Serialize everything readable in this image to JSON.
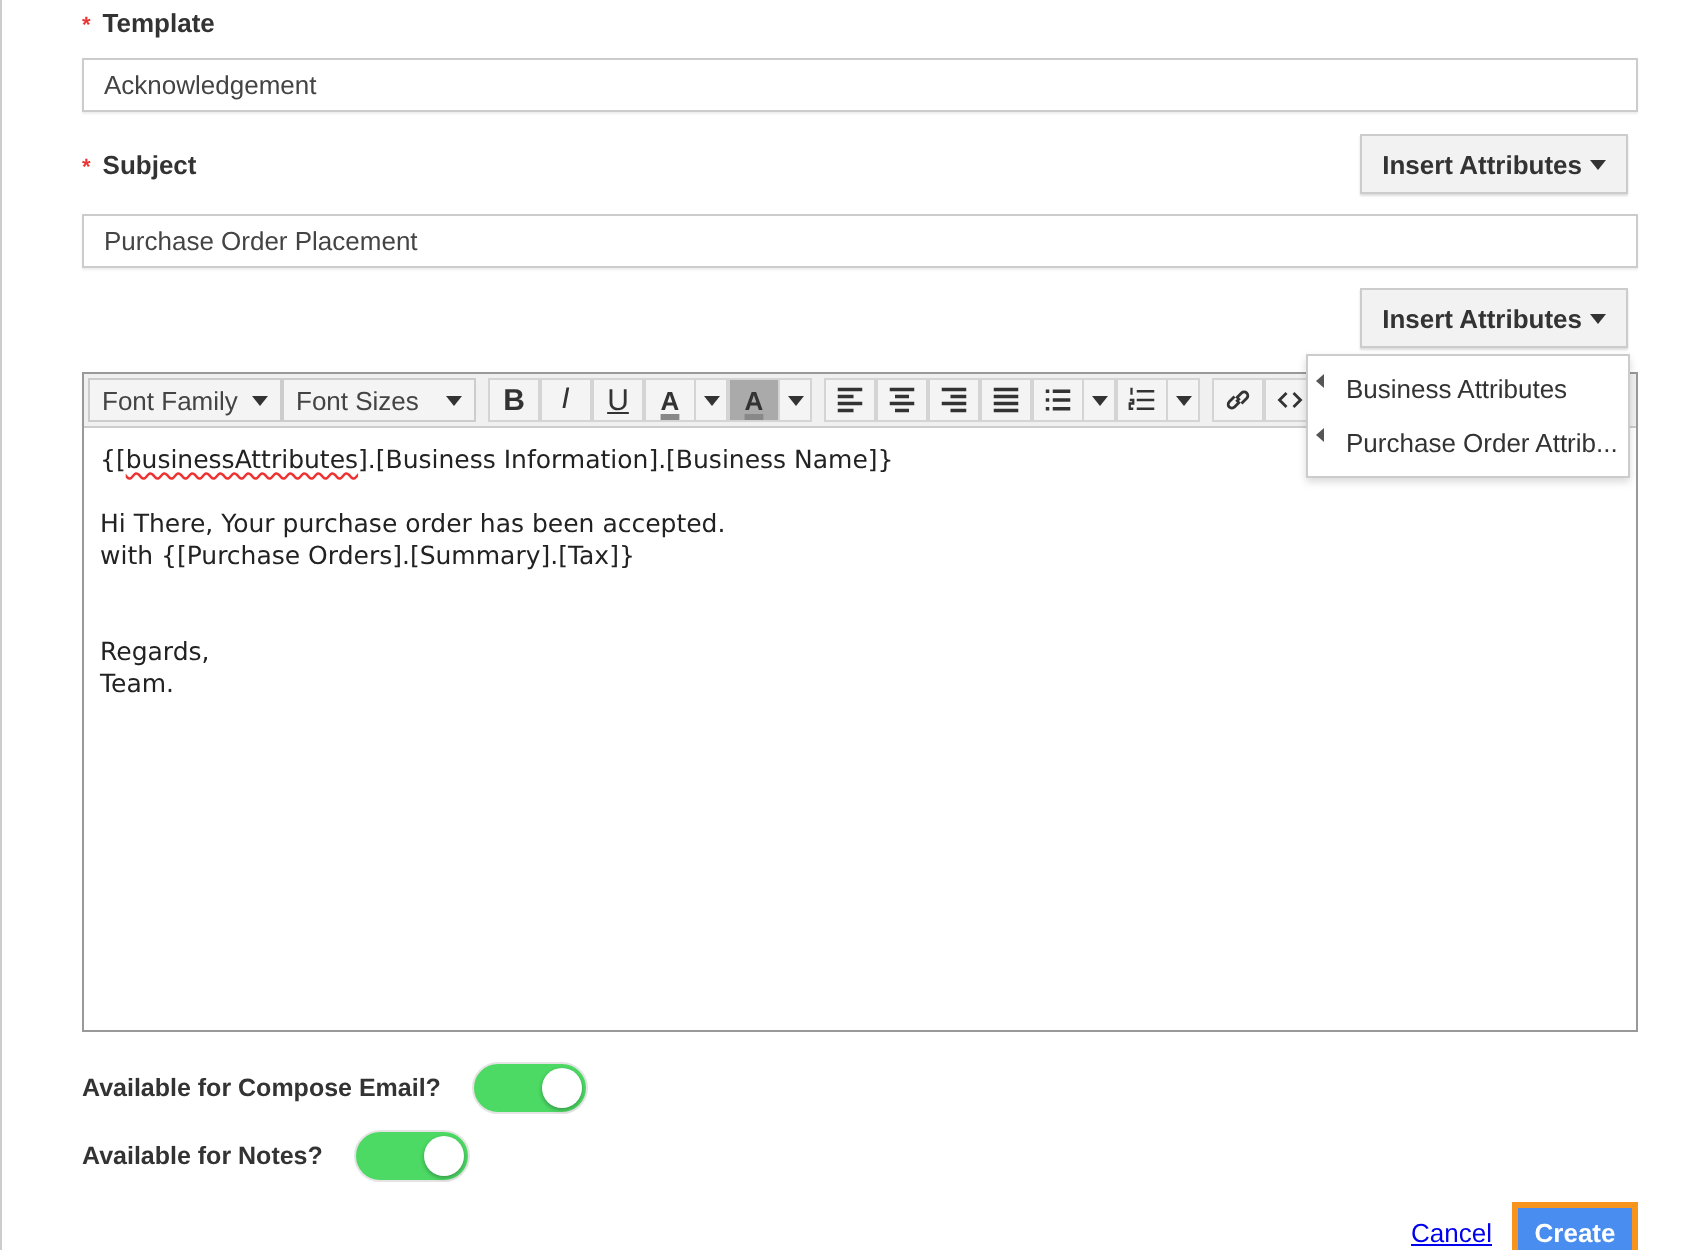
{
  "template": {
    "required_mark": "*",
    "label": "Template",
    "value": "Acknowledgement"
  },
  "subject": {
    "required_mark": "*",
    "label": "Subject",
    "value": "Purchase Order Placement",
    "insert_button": "Insert Attributes"
  },
  "body_insert": {
    "button": "Insert Attributes",
    "expanded": true,
    "menu": [
      {
        "label": "Business Attributes"
      },
      {
        "label": "Purchase Order Attrib..."
      }
    ]
  },
  "toolbar": [
    {
      "kind": "select",
      "label": "Font Family"
    },
    {
      "kind": "select",
      "label": "Font Sizes"
    },
    {
      "kind": "sep"
    },
    {
      "kind": "bold",
      "label": "B"
    },
    {
      "kind": "italic",
      "label": "I"
    },
    {
      "kind": "underline",
      "label": "U"
    },
    {
      "kind": "textcolor",
      "label": "A"
    },
    {
      "kind": "bgcolor",
      "label": "A"
    },
    {
      "kind": "sep"
    },
    {
      "kind": "alignleft"
    },
    {
      "kind": "aligncenter"
    },
    {
      "kind": "alignright"
    },
    {
      "kind": "justify"
    },
    {
      "kind": "bullets"
    },
    {
      "kind": "numbers"
    },
    {
      "kind": "sep"
    },
    {
      "kind": "link"
    },
    {
      "kind": "code"
    }
  ],
  "editor_lines": [
    {
      "kind": "text",
      "segments": [
        {
          "text": "{[",
          "misspelled": false
        },
        {
          "text": "businessAttributes",
          "misspelled": true
        },
        {
          "text": "].[Business Information].[Business Name]}",
          "misspelled": false
        }
      ]
    },
    {
      "kind": "blank"
    },
    {
      "kind": "text",
      "segments": [
        {
          "text": "Hi There, Your purchase order has been accepted.",
          "misspelled": false
        }
      ]
    },
    {
      "kind": "text",
      "segments": [
        {
          "text": "with {[Purchase Orders].[Summary].[Tax]}",
          "misspelled": false
        }
      ]
    },
    {
      "kind": "blank"
    },
    {
      "kind": "blank"
    },
    {
      "kind": "text",
      "segments": [
        {
          "text": "Regards,",
          "misspelled": false
        }
      ]
    },
    {
      "kind": "text",
      "segments": [
        {
          "text": "Team.",
          "misspelled": false
        }
      ]
    }
  ],
  "toggles": [
    {
      "label": "Available for Compose Email?",
      "on": true
    },
    {
      "label": "Available for Notes?",
      "on": true
    }
  ],
  "actions": {
    "cancel": "Cancel",
    "create": "Create",
    "create_focused": true
  }
}
